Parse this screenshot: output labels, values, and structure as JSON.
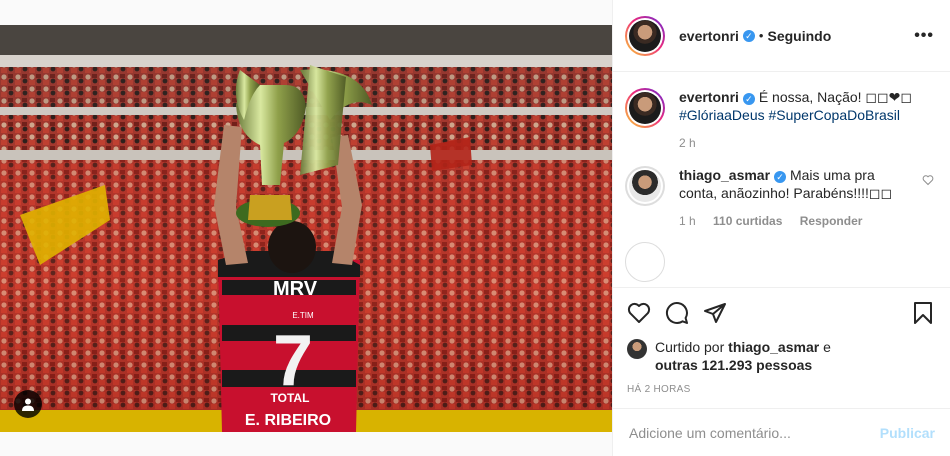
{
  "post": {
    "author": "evertonri",
    "following_label": "Seguindo",
    "image_texts": {
      "sponsor": "MRV",
      "number": "7",
      "name": "E. RIBEIRO",
      "sponsor2": "TOTAL",
      "number_label": "E.TIM"
    }
  },
  "caption": {
    "username": "evertonri",
    "text": "É nossa, Nação! ◻◻❤◻",
    "hashtags": "#GlóriaaDeus #SuperCopaDoBrasil",
    "time": "2 h"
  },
  "comment": {
    "username": "thiago_asmar",
    "text": "Mais uma pra conta, anãozinho! Parabéns!!!!◻◻",
    "time": "1 h",
    "likes": "110 curtidas",
    "reply": "Responder"
  },
  "likes": {
    "prefix": "Curtido por",
    "user": "thiago_asmar",
    "connector": "e",
    "others": "outras 121.293 pessoas"
  },
  "timestamp": "HÁ 2 HORAS",
  "add_comment": {
    "placeholder": "Adicione um comentário...",
    "publish": "Publicar"
  },
  "colors": {
    "accent": "#3897f0",
    "publish_disabled": "#b2dffc",
    "jersey_red": "#c8102e"
  }
}
